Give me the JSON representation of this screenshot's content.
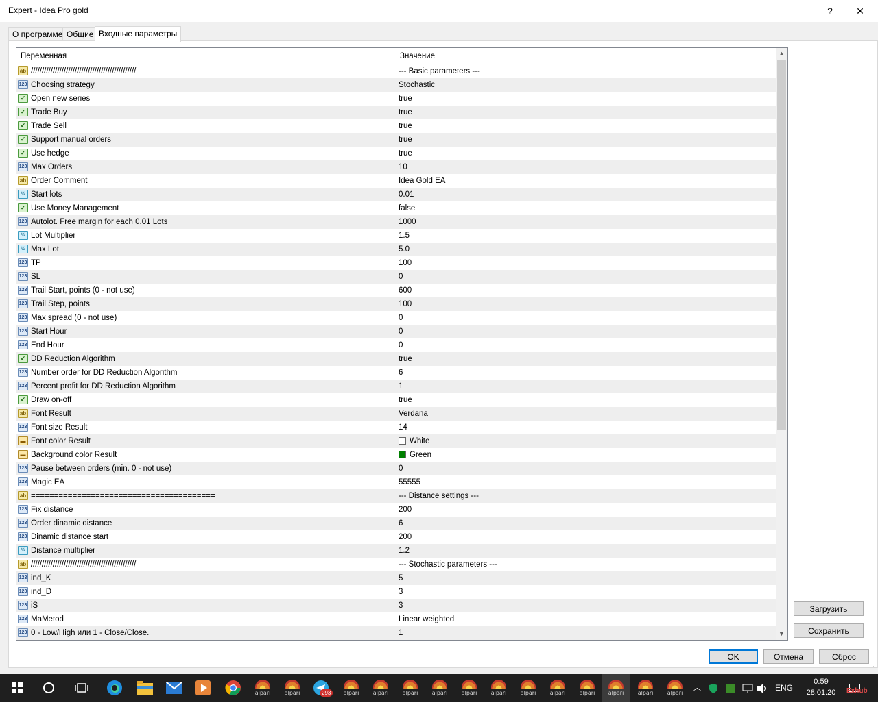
{
  "window": {
    "title": "Expert - Idea Pro gold",
    "help_glyph": "?",
    "close_glyph": "✕"
  },
  "tabs": [
    {
      "label": "О программе"
    },
    {
      "label": "Общие"
    },
    {
      "label": "Входные параметры"
    }
  ],
  "grid": {
    "col_variable": "Переменная",
    "col_value": "Значение",
    "rows": [
      {
        "icon": "ab",
        "name": "////////////////////////////////////////////////",
        "value": "--- Basic parameters ---"
      },
      {
        "icon": "123",
        "name": "Choosing  strategy",
        "value": "Stochastic"
      },
      {
        "icon": "bool",
        "name": "Open new series",
        "value": "true"
      },
      {
        "icon": "bool",
        "name": "Trade Buy",
        "value": "true"
      },
      {
        "icon": "bool",
        "name": "Trade Sell",
        "value": "true"
      },
      {
        "icon": "bool",
        "name": "Support manual orders",
        "value": "true"
      },
      {
        "icon": "bool",
        "name": "Use hedge",
        "value": "true"
      },
      {
        "icon": "123",
        "name": "Max Orders",
        "value": "10"
      },
      {
        "icon": "ab",
        "name": "Order Comment",
        "value": "Idea Gold EA"
      },
      {
        "icon": "dbl",
        "name": "Start lots",
        "value": "0.01"
      },
      {
        "icon": "bool",
        "name": "Use Money Management",
        "value": "false"
      },
      {
        "icon": "123",
        "name": "Autolot. Free margin for each 0.01 Lots",
        "value": "1000"
      },
      {
        "icon": "dbl",
        "name": "Lot Multiplier",
        "value": "1.5"
      },
      {
        "icon": "dbl",
        "name": "Max Lot",
        "value": "5.0"
      },
      {
        "icon": "123",
        "name": "TP",
        "value": "100"
      },
      {
        "icon": "123",
        "name": "SL",
        "value": "0"
      },
      {
        "icon": "123",
        "name": "Trail Start, points (0 - not use)",
        "value": "600"
      },
      {
        "icon": "123",
        "name": "Trail Step, points",
        "value": "100"
      },
      {
        "icon": "123",
        "name": "Max spread (0 - not use)",
        "value": "0"
      },
      {
        "icon": "123",
        "name": "Start Hour",
        "value": "0"
      },
      {
        "icon": "123",
        "name": "End Hour",
        "value": "0"
      },
      {
        "icon": "bool",
        "name": "DD Reduction Algorithm",
        "value": "true"
      },
      {
        "icon": "123",
        "name": "Number order for DD Reduction Algorithm",
        "value": "6"
      },
      {
        "icon": "123",
        "name": "Percent profit for DD Reduction Algorithm",
        "value": "1"
      },
      {
        "icon": "bool",
        "name": "Draw on-off",
        "value": "true"
      },
      {
        "icon": "ab",
        "name": "Font Result",
        "value": "Verdana"
      },
      {
        "icon": "123",
        "name": "Font size Result",
        "value": "14"
      },
      {
        "icon": "col",
        "name": "Font color Result",
        "value": "White",
        "swatch": "#ffffff"
      },
      {
        "icon": "col",
        "name": "Background color Result",
        "value": "Green",
        "swatch": "#008000"
      },
      {
        "icon": "123",
        "name": "Pause between orders (min. 0 - not use)",
        "value": "0"
      },
      {
        "icon": "123",
        "name": "Magic EA",
        "value": "55555"
      },
      {
        "icon": "ab",
        "name": "========================================",
        "value": "--- Distance settings ---"
      },
      {
        "icon": "123",
        "name": "Fix distance",
        "value": "200"
      },
      {
        "icon": "123",
        "name": "Order dinamic distance",
        "value": "6"
      },
      {
        "icon": "123",
        "name": "Dinamic distance start",
        "value": "200"
      },
      {
        "icon": "dbl",
        "name": "Distance multiplier",
        "value": "1.2"
      },
      {
        "icon": "ab",
        "name": "////////////////////////////////////////////////",
        "value": "--- Stochastic parameters ---"
      },
      {
        "icon": "123",
        "name": "ind_K",
        "value": "5"
      },
      {
        "icon": "123",
        "name": "ind_D",
        "value": "3"
      },
      {
        "icon": "123",
        "name": "iS",
        "value": "3"
      },
      {
        "icon": "123",
        "name": "MaMetod",
        "value": "Linear weighted"
      },
      {
        "icon": "123",
        "name": "0 - Low/High или 1 - Close/Close.",
        "value": "1"
      }
    ]
  },
  "side_buttons": {
    "load": "Загрузить",
    "save": "Сохранить"
  },
  "footer_buttons": {
    "ok": "OK",
    "cancel": "Отмена",
    "reset": "Сброс"
  },
  "icon_glyphs": {
    "ab": "ab",
    "123": "123",
    "bool": "✓",
    "dbl": "½",
    "col": "▬"
  },
  "taskbar": {
    "alpari_label": "alpari",
    "telegram_badge": "293",
    "lang": "ENG",
    "time": "0:59",
    "date": "28.01.20",
    "watermark": "Exhub"
  }
}
